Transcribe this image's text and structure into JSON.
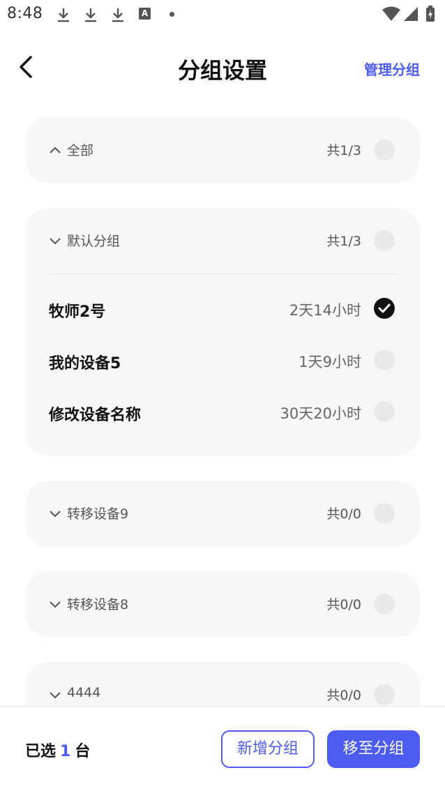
{
  "status_bar": {
    "time": "8:48",
    "badge": "A",
    "icons": [
      "download-icon",
      "download-icon",
      "download-icon",
      "app-badge-icon",
      "dot-icon",
      "wifi-icon",
      "signal-icon",
      "battery-icon"
    ]
  },
  "header": {
    "title": "分组设置",
    "manage_label": "管理分组"
  },
  "groups": [
    {
      "name": "全部",
      "count": "共1/3",
      "expanded": true,
      "checked": false
    },
    {
      "name": "默认分组",
      "count": "共1/3",
      "expanded": false,
      "checked": false,
      "devices": [
        {
          "name": "牧师2号",
          "time": "2天14小时",
          "checked": true
        },
        {
          "name": "我的设备5",
          "time": "1天9小时",
          "checked": false
        },
        {
          "name": "修改设备名称",
          "time": "30天20小时",
          "checked": false
        }
      ]
    },
    {
      "name": "转移设备9",
      "count": "共0/0",
      "expanded": false,
      "checked": false
    },
    {
      "name": "转移设备8",
      "count": "共0/0",
      "expanded": false,
      "checked": false
    },
    {
      "name": "4444",
      "count": "共0/0",
      "expanded": false,
      "checked": false
    }
  ],
  "footer": {
    "selected_prefix": "已选",
    "selected_count": "1",
    "selected_suffix": "台",
    "new_group_label": "新增分组",
    "move_label": "移至分组"
  },
  "colors": {
    "accent": "#4c5cf0",
    "card_bg": "#f7f7f7",
    "circle_bg": "#e9e9e9"
  }
}
